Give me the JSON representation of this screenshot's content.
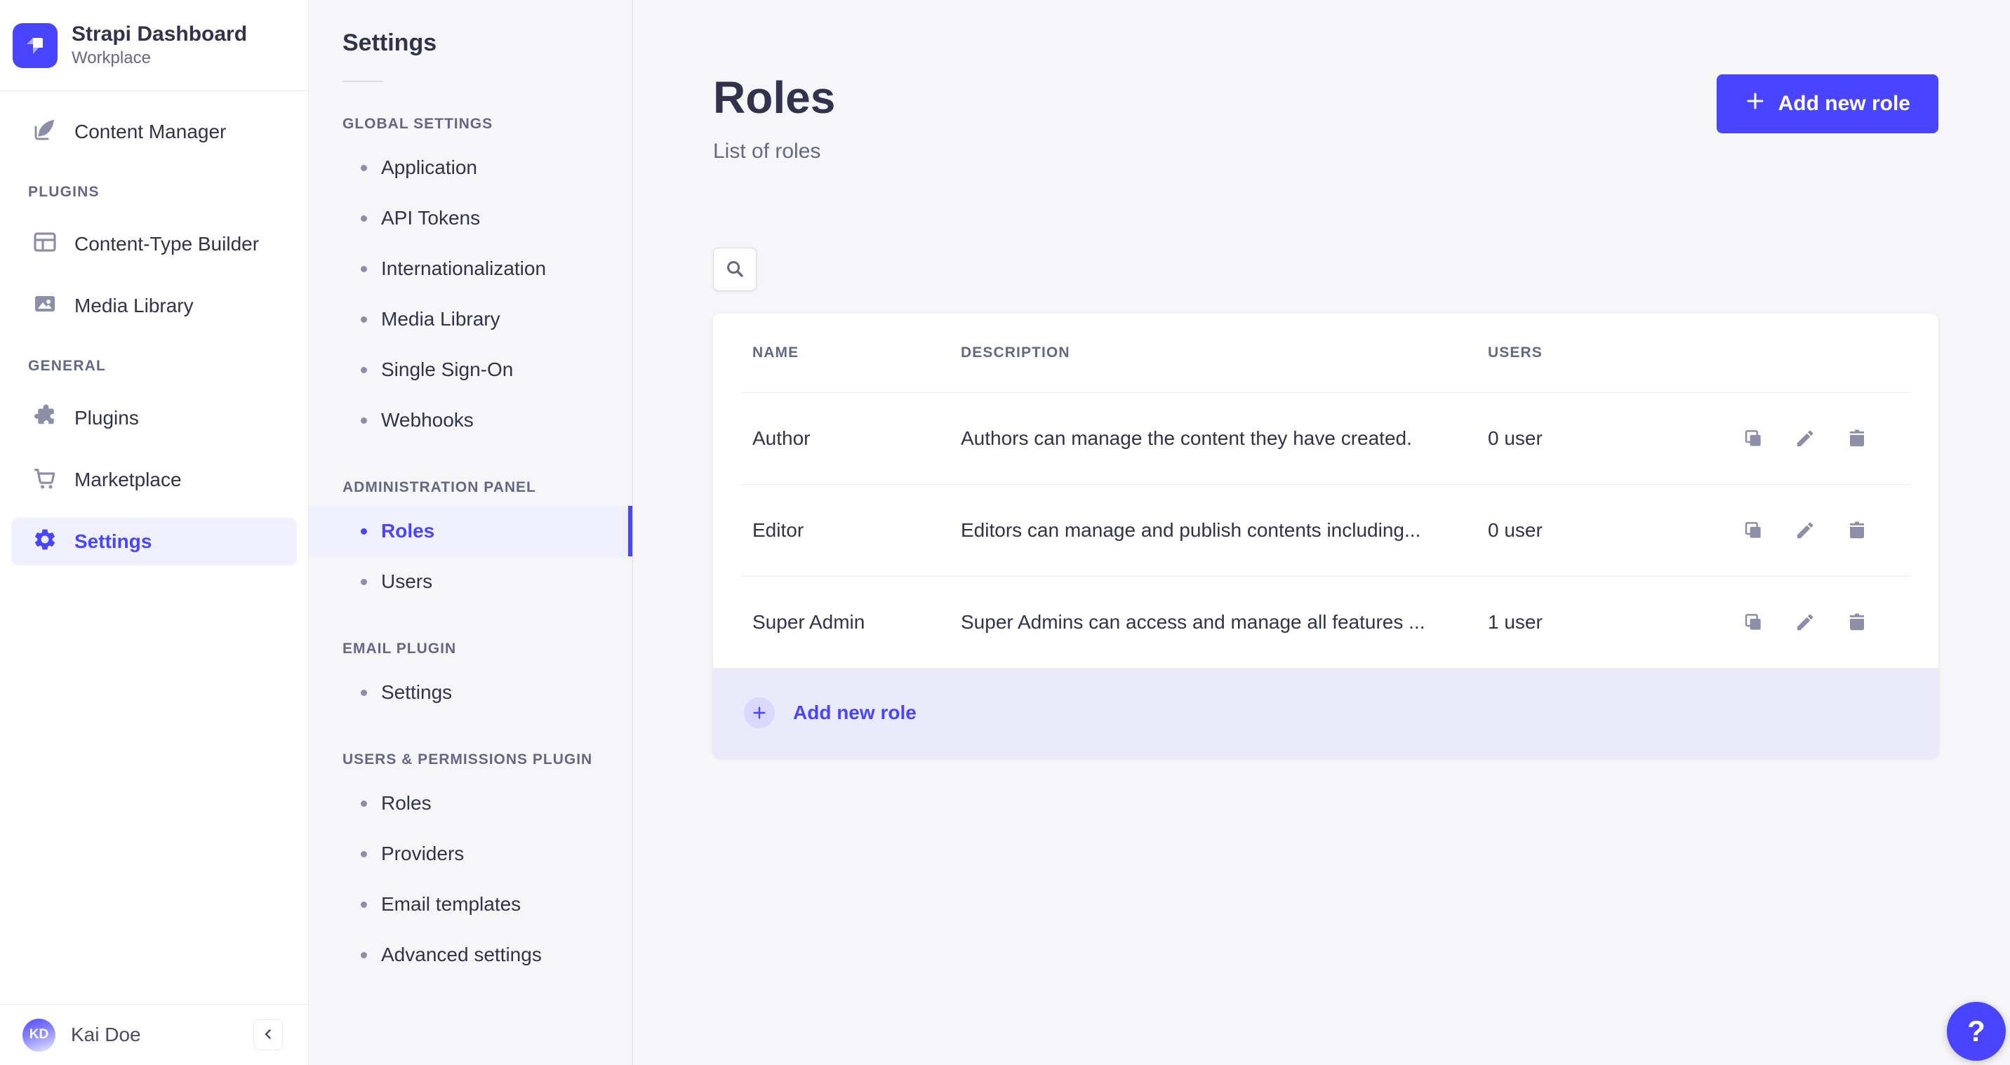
{
  "brand": {
    "name": "Strapi Dashboard",
    "workspace": "Workplace"
  },
  "main_nav": {
    "content_manager": "Content Manager",
    "sections": [
      {
        "title": "PLUGINS",
        "items": [
          "Content-Type Builder",
          "Media Library"
        ]
      },
      {
        "title": "GENERAL",
        "items": [
          "Plugins",
          "Marketplace",
          "Settings"
        ]
      }
    ],
    "active_item": "Settings",
    "user": {
      "initials": "KD",
      "name": "Kai Doe"
    }
  },
  "settings_nav": {
    "title": "Settings",
    "sections": [
      {
        "title": "GLOBAL SETTINGS",
        "items": [
          "Application",
          "API Tokens",
          "Internationalization",
          "Media Library",
          "Single Sign-On",
          "Webhooks"
        ]
      },
      {
        "title": "ADMINISTRATION PANEL",
        "items": [
          "Roles",
          "Users"
        ],
        "active_item": "Roles"
      },
      {
        "title": "EMAIL PLUGIN",
        "items": [
          "Settings"
        ]
      },
      {
        "title": "USERS & PERMISSIONS PLUGIN",
        "items": [
          "Roles",
          "Providers",
          "Email templates",
          "Advanced settings"
        ]
      }
    ]
  },
  "page": {
    "title": "Roles",
    "subtitle": "List of roles",
    "add_button_label": "Add new role",
    "help_label": "?"
  },
  "table": {
    "columns": [
      "NAME",
      "DESCRIPTION",
      "USERS"
    ],
    "rows": [
      {
        "name": "Author",
        "description": "Authors can manage the content they have created.",
        "users": "0 user"
      },
      {
        "name": "Editor",
        "description": "Editors can manage and publish contents including...",
        "users": "0 user"
      },
      {
        "name": "Super Admin",
        "description": "Super Admins can access and manage all features ...",
        "users": "1 user"
      }
    ],
    "footer_add_label": "Add new role"
  },
  "icons": {
    "strapi_logo": "strapi-mark",
    "content_manager": "feather-pen",
    "content_type_builder": "layout-grid",
    "media_library": "picture",
    "plugins": "puzzle-piece",
    "marketplace": "shopping-cart",
    "settings": "gear",
    "search": "magnifier",
    "duplicate": "copy-squares",
    "edit": "pencil",
    "delete": "trash-can",
    "collapse": "chevron-left",
    "add": "plus",
    "help": "question-mark"
  },
  "colors": {
    "primary": "#4945ff",
    "primary_light": "#f0f0ff",
    "primary_soft": "#d9d8ff",
    "footer_bg": "#eaeafb",
    "text_dark": "#32324d",
    "text_muted": "#666687",
    "icon_muted": "#8e8ea9",
    "border": "#eaeaef",
    "surface": "#ffffff",
    "background": "#f6f6f9"
  }
}
